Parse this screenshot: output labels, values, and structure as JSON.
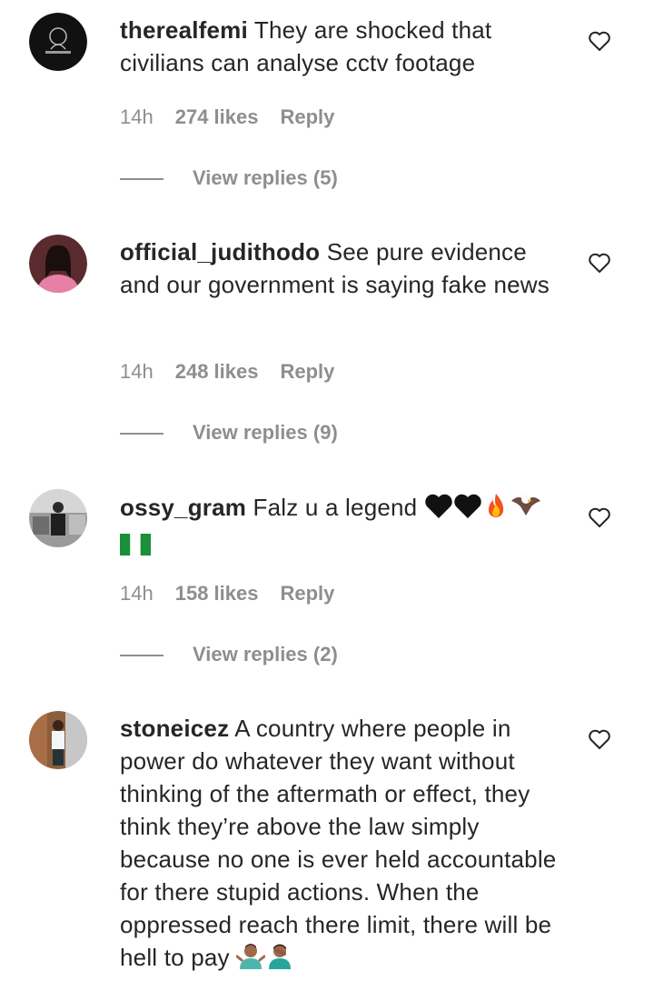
{
  "comments": [
    {
      "username": "therealfemi",
      "text": "They are shocked that civilians can analyse cctv footage",
      "time": "14h",
      "likes": "274 likes",
      "reply": "Reply",
      "view_replies": "View replies (5)"
    },
    {
      "username": "official_judithodo",
      "text": "See pure evidence and our government is saying fake news",
      "time": "14h",
      "likes": "248 likes",
      "reply": "Reply",
      "view_replies": "View replies (9)"
    },
    {
      "username": "ossy_gram",
      "text": "Falz u a legend",
      "emojis": [
        "black-heart-emoji",
        "black-heart-emoji",
        "fire-emoji",
        "eagle-emoji",
        "nigeria-flag-emoji"
      ],
      "time": "14h",
      "likes": "158 likes",
      "reply": "Reply",
      "view_replies": "View replies (2)"
    },
    {
      "username": "stoneicez",
      "text": "A country where people in power do whatever they want without thinking of the aftermath or effect, they think they’re above the law simply because no one is ever held accountable for there stupid actions. When the oppressed reach there limit, there will be hell to pay",
      "emojis": [
        "person-shrugging-emoji",
        "man-facepalming-emoji"
      ]
    }
  ],
  "colors": {
    "text": "#262626",
    "secondary": "#8e8e8e",
    "background": "#ffffff"
  }
}
